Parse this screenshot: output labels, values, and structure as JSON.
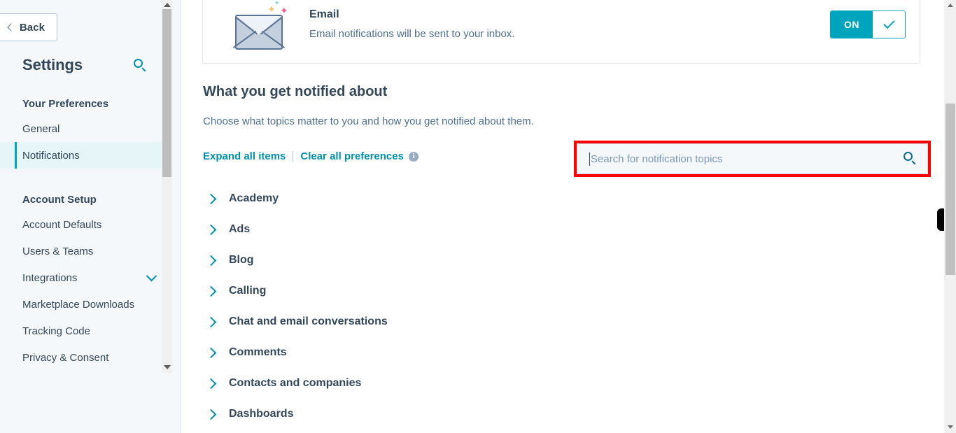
{
  "sidebar": {
    "back_label": "Back",
    "title": "Settings",
    "search_icon": "search-icon",
    "sections": [
      {
        "heading": "Your Preferences",
        "items": [
          {
            "label": "General",
            "active": false,
            "caret": false
          },
          {
            "label": "Notifications",
            "active": true,
            "caret": false
          }
        ]
      },
      {
        "heading": "Account Setup",
        "items": [
          {
            "label": "Account Defaults",
            "active": false,
            "caret": false
          },
          {
            "label": "Users & Teams",
            "active": false,
            "caret": false
          },
          {
            "label": "Integrations",
            "active": false,
            "caret": true
          },
          {
            "label": "Marketplace Downloads",
            "active": false,
            "caret": false
          },
          {
            "label": "Tracking Code",
            "active": false,
            "caret": false
          },
          {
            "label": "Privacy & Consent",
            "active": false,
            "caret": false
          }
        ]
      }
    ]
  },
  "email_card": {
    "icon": "envelope-icon",
    "title": "Email",
    "description": "Email notifications will be sent to your inbox.",
    "toggle_label": "ON",
    "toggle_state": "on",
    "toggle_accent": "#00a4bd"
  },
  "section": {
    "title": "What you get notified about",
    "subtitle": "Choose what topics matter to you and how you get notified about them.",
    "expand_all": "Expand all items",
    "clear_all": "Clear all preferences",
    "info_glyph": "i"
  },
  "search": {
    "placeholder": "Search for notification topics",
    "value": "",
    "icon": "search-icon",
    "highlight_color": "#ff0000"
  },
  "topics": [
    {
      "label": "Academy"
    },
    {
      "label": "Ads"
    },
    {
      "label": "Blog"
    },
    {
      "label": "Calling"
    },
    {
      "label": "Chat and email conversations"
    },
    {
      "label": "Comments"
    },
    {
      "label": "Contacts and companies"
    },
    {
      "label": "Dashboards"
    }
  ]
}
